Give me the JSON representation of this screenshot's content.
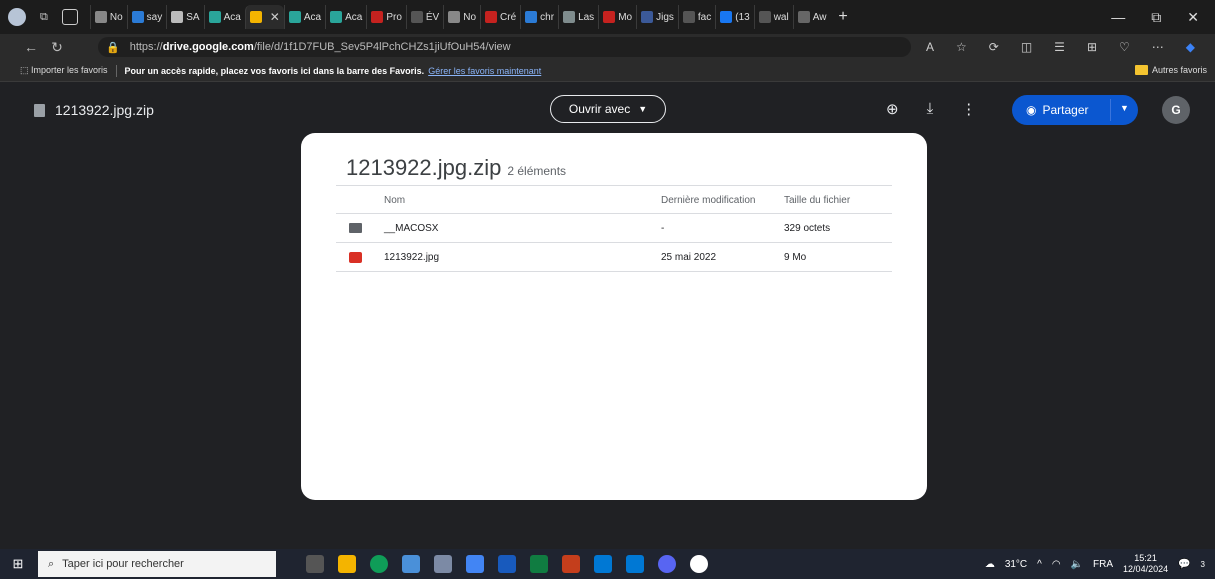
{
  "browser": {
    "tabs": [
      {
        "label": "No",
        "color": "#888888"
      },
      {
        "label": "say",
        "color": "#2b7bd6"
      },
      {
        "label": "SA",
        "color": "#bbbbbb"
      },
      {
        "label": "Aca",
        "color": "#2aa59a"
      },
      {
        "label": "",
        "color": "#f4b400",
        "active": true
      },
      {
        "label": "Aca",
        "color": "#2aa59a"
      },
      {
        "label": "Aca",
        "color": "#2aa59a"
      },
      {
        "label": "Pro",
        "color": "#c5221f"
      },
      {
        "label": "ÉV",
        "color": "#555555"
      },
      {
        "label": "No",
        "color": "#888888"
      },
      {
        "label": "Cré",
        "color": "#c5221f"
      },
      {
        "label": "chr",
        "color": "#2b7bd6"
      },
      {
        "label": "Las",
        "color": "#7f8c8d"
      },
      {
        "label": "Mo",
        "color": "#c5221f"
      },
      {
        "label": "Jigs",
        "color": "#3b5998"
      },
      {
        "label": "fac",
        "color": "#555555"
      },
      {
        "label": "(13",
        "color": "#1877f2"
      },
      {
        "label": "wal",
        "color": "#555555"
      },
      {
        "label": "Aw",
        "color": "#666666"
      }
    ],
    "new_tab": "+",
    "url_prefix": "https://",
    "url_host": "drive.google.com",
    "url_path": "/file/d/1f1D7FUB_Sev5P4lPchCHZs1jiUfOuH54/view"
  },
  "favorites_bar": {
    "import_label": "Importer les favoris",
    "hint": "Pour un accès rapide, placez vos favoris ici dans la barre des Favoris.",
    "manage_link": "Gérer les favoris maintenant",
    "other_favorites": "Autres favoris"
  },
  "drive": {
    "file_name": "1213922.jpg.zip",
    "open_with_label": "Ouvrir avec",
    "share_label": "Partager",
    "user_initial": "G"
  },
  "card": {
    "title": "1213922.jpg.zip",
    "item_count": "2 éléments",
    "columns": {
      "name": "Nom",
      "modified": "Dernière modification",
      "size": "Taille du fichier"
    },
    "rows": [
      {
        "name": "__MACOSX",
        "modified": "-",
        "size": "329 octets",
        "icon": "folder-icon"
      },
      {
        "name": "1213922.jpg",
        "modified": "25 mai 2022",
        "size": "9 Mo",
        "icon": "image-file-icon"
      }
    ]
  },
  "taskbar": {
    "search_placeholder": "Taper ici pour rechercher",
    "weather": "31°C",
    "language": "FRA",
    "time": "15:21",
    "date": "12/04/2024",
    "notification_count": "3"
  }
}
